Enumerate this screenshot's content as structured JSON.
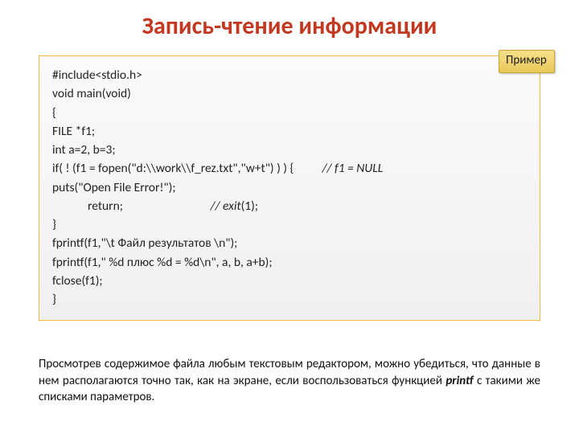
{
  "title": "Запись-чтение информации",
  "badge": "Пример",
  "code": {
    "l1": "#include<stdio.h>",
    "l2": "void main(void)",
    "l3": "{",
    "l4": "FILE *f1;",
    "l5": "int a=2, b=3;",
    "l6a": "if( ! (f1 = fopen(\"d:\\\\work\\\\f_rez.txt\",\"w+t\") ) ) {          ",
    "l6b": "// f1 = NULL",
    "l7": "puts(\"Open File Error!\");",
    "l8a": "return;                               ",
    "l8b": "// exit",
    "l8c": "(1);",
    "l9": "}",
    "l10": "fprintf(f1,\"\\t Файл результатов \\n\");",
    "l11": "fprintf(f1,\" %d плюс %d = %d\\n\", a, b, a+b);",
    "l12": "fclose(f1);",
    "l13": "}"
  },
  "note_pre": "Просмотрев содержимое файла любым текстовым редактором, можно убедиться, что данные в нем располагаются точно так, как на экране, если воспользоваться функцией ",
  "note_bold": "printf",
  "note_post": " с такими же списками параметров."
}
